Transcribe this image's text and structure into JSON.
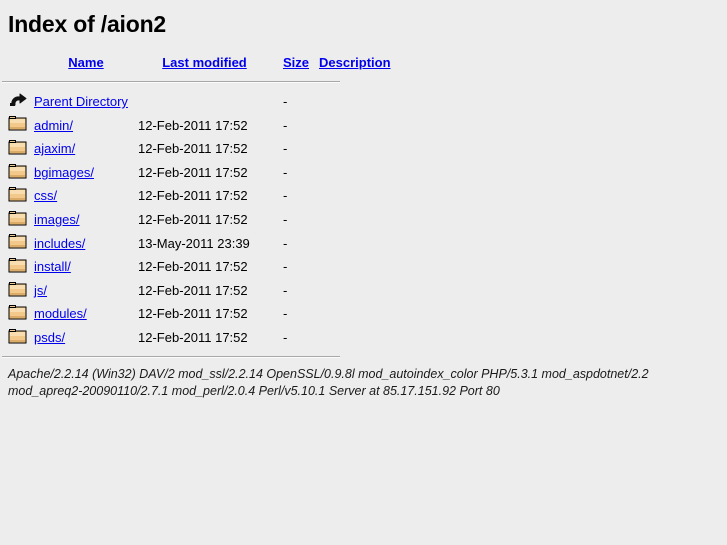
{
  "page": {
    "title": "Index of /aion2",
    "background_color": "#ededed",
    "link_color": "#0000ee",
    "text_color": "#000000"
  },
  "table": {
    "headers": [
      {
        "label": "Name",
        "name": "name"
      },
      {
        "label": "Last modified",
        "name": "last-modified"
      },
      {
        "label": "Size",
        "name": "size"
      },
      {
        "label": "Description",
        "name": "description"
      }
    ],
    "rows": [
      {
        "icon": "parent-directory-icon",
        "name": "Parent Directory",
        "last_modified": "",
        "size": "-",
        "description": ""
      },
      {
        "icon": "folder-icon",
        "name": "admin/",
        "last_modified": "12-Feb-2011 17:52",
        "size": "-",
        "description": ""
      },
      {
        "icon": "folder-icon",
        "name": "ajaxim/",
        "last_modified": "12-Feb-2011 17:52",
        "size": "-",
        "description": ""
      },
      {
        "icon": "folder-icon",
        "name": "bgimages/",
        "last_modified": "12-Feb-2011 17:52",
        "size": "-",
        "description": ""
      },
      {
        "icon": "folder-icon",
        "name": "css/",
        "last_modified": "12-Feb-2011 17:52",
        "size": "-",
        "description": ""
      },
      {
        "icon": "folder-icon",
        "name": "images/",
        "last_modified": "12-Feb-2011 17:52",
        "size": "-",
        "description": ""
      },
      {
        "icon": "folder-icon",
        "name": "includes/",
        "last_modified": "13-May-2011 23:39",
        "size": "-",
        "description": ""
      },
      {
        "icon": "folder-icon",
        "name": "install/",
        "last_modified": "12-Feb-2011 17:52",
        "size": "-",
        "description": ""
      },
      {
        "icon": "folder-icon",
        "name": "js/",
        "last_modified": "12-Feb-2011 17:52",
        "size": "-",
        "description": ""
      },
      {
        "icon": "folder-icon",
        "name": "modules/",
        "last_modified": "12-Feb-2011 17:52",
        "size": "-",
        "description": ""
      },
      {
        "icon": "folder-icon",
        "name": "psds/",
        "last_modified": "12-Feb-2011 17:52",
        "size": "-",
        "description": ""
      }
    ]
  },
  "footer": {
    "signature": "Apache/2.2.14 (Win32) DAV/2 mod_ssl/2.2.14 OpenSSL/0.9.8l mod_autoindex_color PHP/5.3.1 mod_aspdotnet/2.2 mod_apreq2-20090110/2.7.1 mod_perl/2.0.4 Perl/v5.10.1 Server at 85.17.151.92 Port 80"
  }
}
